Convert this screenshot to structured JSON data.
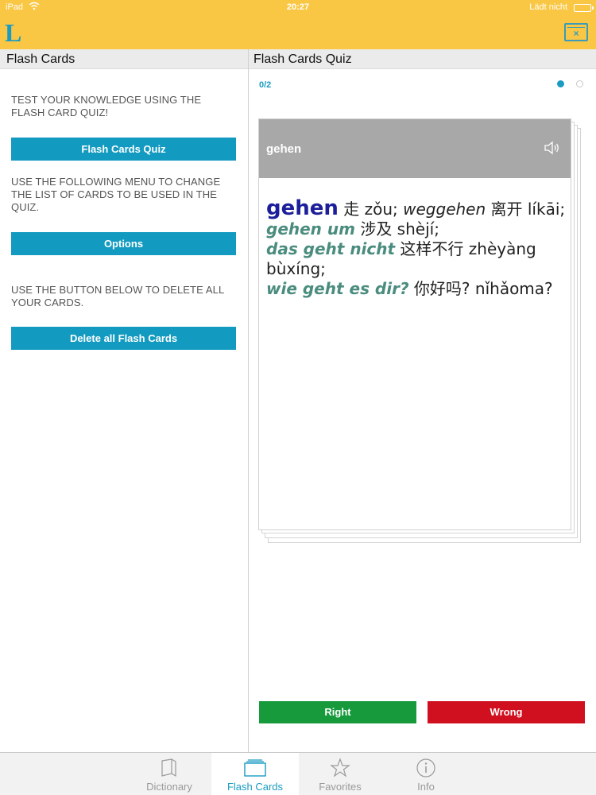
{
  "status_bar": {
    "carrier": "iPad",
    "time": "20:27",
    "charging": "Lädt nicht"
  },
  "header": {
    "logo": "L",
    "close_label": "×"
  },
  "left_pane": {
    "title": "Flash Cards",
    "intro_text": "TEST YOUR KNOWLEDGE USING THE FLASH CARD QUIZ!",
    "quiz_button": "Flash Cards Quiz",
    "menu_text": "USE THE FOLLOWING MENU TO CHANGE THE LIST OF CARDS TO BE USED IN THE QUIZ.",
    "options_button": "Options",
    "delete_text": "USE THE BUTTON BELOW TO DELETE ALL YOUR CARDS.",
    "delete_button": "Delete all Flash Cards"
  },
  "right_pane": {
    "title": "Flash Cards Quiz",
    "counter": "0/2",
    "card_title": "gehen",
    "entry": {
      "headword": "gehen",
      "t1": " 走 zǒu; ",
      "var1": "weggehen",
      "t2": " 离开 líkāi;",
      "ex1": "gehen um",
      "tr1": " 涉及 shèjí;",
      "ex2": "das geht nicht",
      "tr2": " 这样不行 zhèyàng bùxíng;",
      "ex3": "wie geht es dir?",
      "tr3": " 你好吗? nǐhǎoma?"
    },
    "right_button": "Right",
    "wrong_button": "Wrong"
  },
  "tabs": [
    {
      "label": "Dictionary",
      "icon": "book-icon"
    },
    {
      "label": "Flash Cards",
      "icon": "flash-cards-icon"
    },
    {
      "label": "Favorites",
      "icon": "star-icon"
    },
    {
      "label": "Info",
      "icon": "info-icon"
    }
  ],
  "colors": {
    "accent": "#1a9bc2",
    "header": "#f9c744",
    "right": "#169a3c",
    "wrong": "#d0101f"
  }
}
